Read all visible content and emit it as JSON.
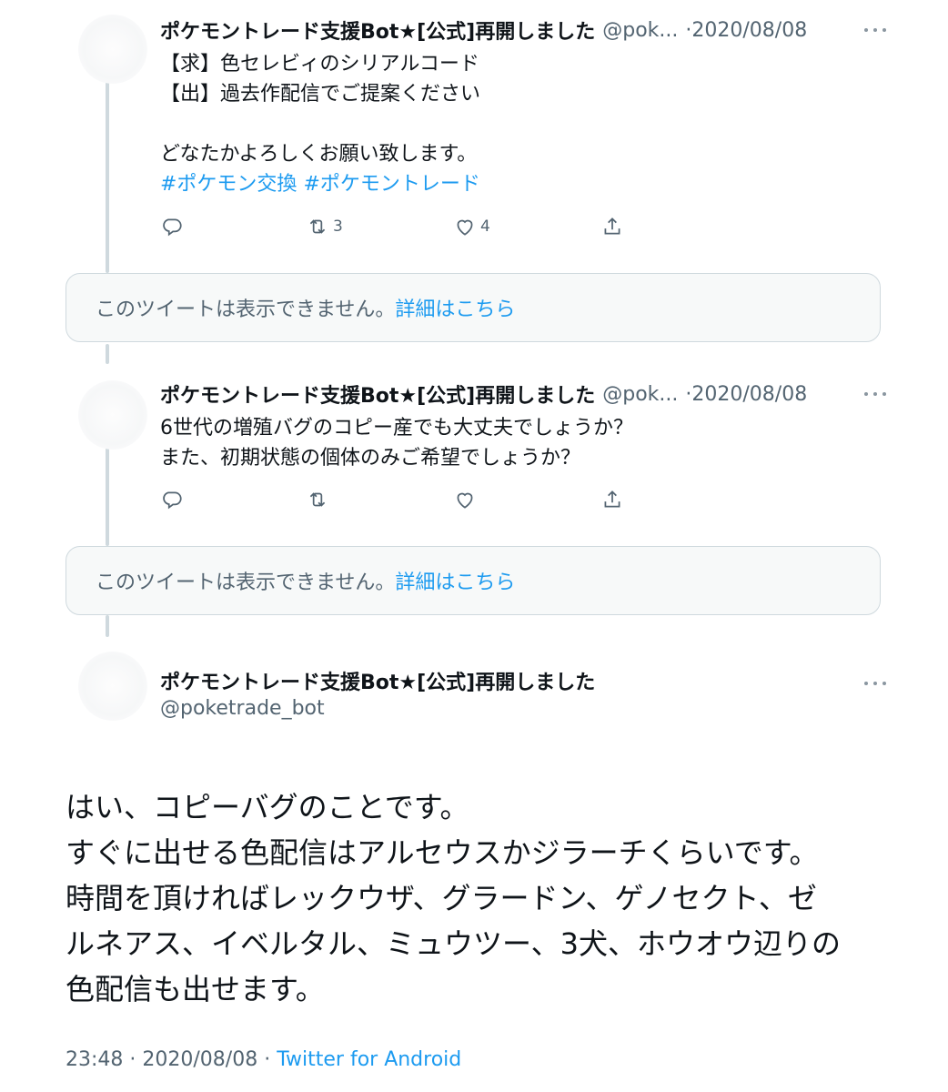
{
  "colors": {
    "text": "#0f1419",
    "secondary": "#536471",
    "link": "#1d9bf0",
    "card_bg": "#f7f9f9",
    "border": "#cfd9de"
  },
  "replies": [
    {
      "display_name": "ポケモントレード支援Bot★[公式]再開しました",
      "handle": "@pok...",
      "separator": "·",
      "date": "2020/08/08",
      "lines": [
        "【求】色セレビィのシリアルコード",
        "【出】過去作配信でご提案ください",
        "",
        "どなたかよろしくお願い致します。"
      ],
      "hashtags": [
        "#ポケモン交換",
        "#ポケモントレード"
      ],
      "retweets": "3",
      "likes": "4"
    },
    {
      "display_name": "ポケモントレード支援Bot★[公式]再開しました",
      "handle": "@pok...",
      "separator": "·",
      "date": "2020/08/08",
      "lines": [
        "6世代の増殖バグのコピー産でも大丈夫でしょうか？",
        "また、初期状態の個体のみご希望でしょうか？"
      ]
    }
  ],
  "unavailable": {
    "message": "このツイートは表示できません。",
    "link": "詳細はこちら"
  },
  "main_tweet": {
    "display_name": "ポケモントレード支援Bot★[公式]再開しました",
    "handle": "@poketrade_bot",
    "lines": [
      "はい、コピーバグのことです。",
      "すぐに出せる色配信はアルセウスかジラーチくらいです。",
      "時間を頂ければレックウザ、グラードン、ゲノセクト、ゼ",
      "ルネアス、イベルタル、ミュウツー、3犬、ホウオウ辺りの",
      "色配信も出せます。"
    ],
    "time": "23:48",
    "separator": "·",
    "date": "2020/08/08",
    "source": "Twitter for Android"
  },
  "icons": [
    "reply-icon",
    "retweet-icon",
    "like-icon",
    "share-icon",
    "more-icon"
  ]
}
